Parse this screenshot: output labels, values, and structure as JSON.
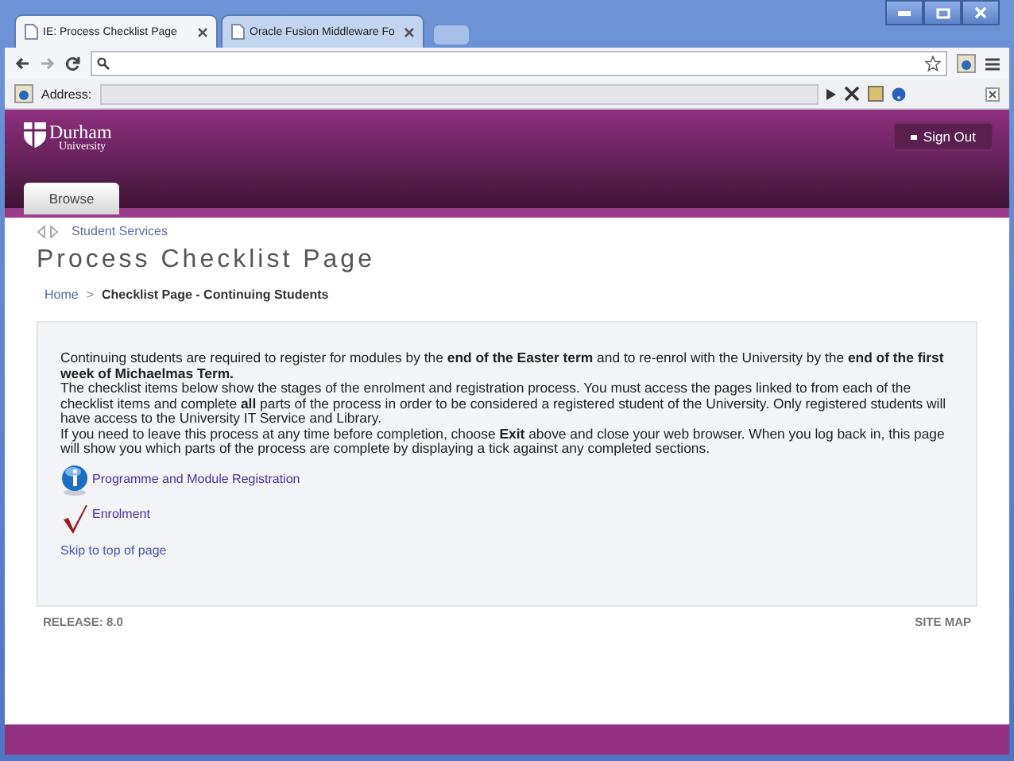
{
  "browser": {
    "tabs": [
      {
        "title": "IE: Process Checklist Page",
        "selected": true
      },
      {
        "title": "Oracle Fusion Middleware Fo",
        "selected": false
      }
    ],
    "address_label": "Address:"
  },
  "header": {
    "logo": {
      "name": "Durham",
      "sub": "University"
    },
    "sign_out": "Sign Out",
    "browse": "Browse"
  },
  "breadcrumb_top": "Student Services",
  "page_title": "Process Checklist Page",
  "breadcrumb": {
    "home": "Home",
    "separator": ">",
    "current": "Checklist Page - Continuing Students"
  },
  "intro": [
    "Continuing students are required to register for modules by the **end of the Easter term** and to re-enrol with the University by the **end of the first week of Michaelmas Term.**",
    "The checklist items below show the stages of the enrolment and registration process. You must access the pages linked to from each of the checklist items and complete **all** parts of the process in order to be considered a registered student of the University. Only registered students will have access to the University IT Service and Library.",
    "If you need to leave this process at any time before completion, choose **Exit** above and close your web browser. When you log back in, this page will show you which parts of the process are complete by displaying a tick against any completed sections."
  ],
  "checklist": [
    {
      "kind": "info",
      "label": "Programme and Module Registration"
    },
    {
      "kind": "tick",
      "label": "Enrolment"
    }
  ],
  "skip_link": "Skip to top of page",
  "footer": {
    "release": "RELEASE: 8.0",
    "site_map": "SITE MAP"
  }
}
